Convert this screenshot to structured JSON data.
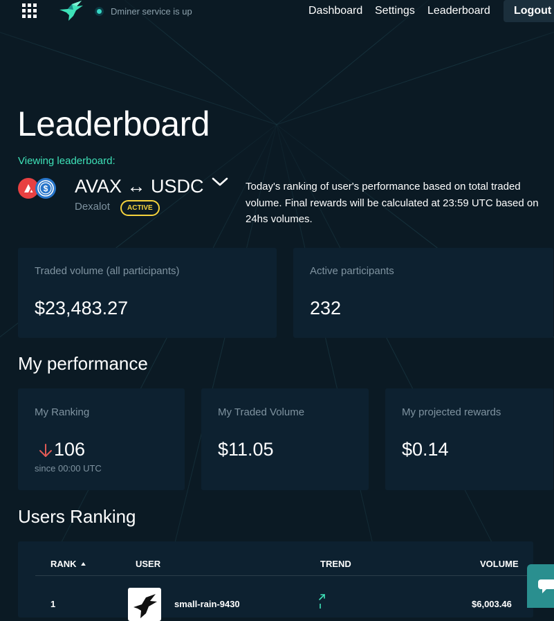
{
  "nav": {
    "status_text": "Dminer service is up",
    "links": [
      "Dashboard",
      "Settings",
      "Leaderboard"
    ],
    "logout_label": "Logout"
  },
  "header": {
    "title": "Leaderboard",
    "viewing_label": "Viewing leaderboard:",
    "pair": "AVAX ↔ USDC",
    "exchange": "Dexalot",
    "status_badge": "ACTIVE",
    "description": "Today's ranking of user's performance based on total traded volume. Final rewards will be calculated at 23:59 UTC based on 24hs volumes."
  },
  "summary": {
    "traded_volume_label": "Traded volume (all participants)",
    "traded_volume_value": "$23,483.27",
    "participants_label": "Active participants",
    "participants_value": "232"
  },
  "my_performance": {
    "title": "My performance",
    "ranking_label": "My Ranking",
    "ranking_value": "106",
    "ranking_trend": "down",
    "ranking_since": "since 00:00 UTC",
    "volume_label": "My Traded Volume",
    "volume_value": "$11.05",
    "rewards_label": "My projected rewards",
    "rewards_value": "$0.14"
  },
  "ranking": {
    "title": "Users Ranking",
    "columns": [
      "RANK",
      "USER",
      "TREND",
      "VOLUME"
    ],
    "sort_column": "RANK",
    "sort_direction": "ascending",
    "rows": [
      {
        "rank": "1",
        "user": "small-rain-9430",
        "trend": "up",
        "volume": "$6,003.46"
      }
    ]
  },
  "colors": {
    "background": "#0b1a24",
    "card": "#0d2130",
    "accent_teal": "#3ee2b8",
    "badge_yellow": "#f5d33d",
    "down_red": "#e05a55",
    "muted_text": "#7f93a0"
  },
  "icons": {
    "apps": "apps-grid-icon",
    "logo": "hummingbird-logo-icon",
    "pair_dropdown": "chevron-down-icon",
    "ranking_trend": "arrow-down-icon",
    "row_trend": "arrow-up-right-icon",
    "chat": "chat-icon"
  }
}
